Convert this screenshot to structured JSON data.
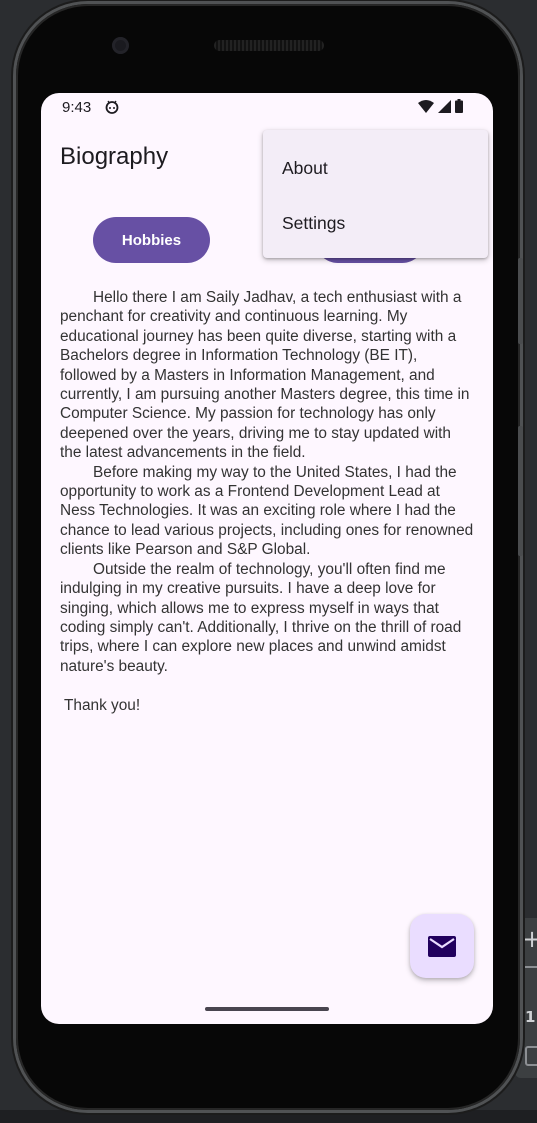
{
  "status_bar": {
    "time": "9:43",
    "left_icon": "android-head-icon",
    "right_icons": [
      "wifi-icon",
      "cell-signal-icon",
      "battery-icon"
    ]
  },
  "app_bar": {
    "title": "Biography"
  },
  "buttons": {
    "hobbies_label": "Hobbies"
  },
  "overflow_menu": {
    "items": [
      {
        "label": "About"
      },
      {
        "label": "Settings"
      }
    ]
  },
  "bio": {
    "paragraphs": [
      "Hello there I am Saily Jadhav, a tech enthusiast with a penchant for creativity and continuous learning. My educational journey has been quite diverse, starting with a Bachelors degree in Information Technology (BE IT), followed by a Masters in Information Management, and currently, I am pursuing another Masters degree, this time in Computer Science. My passion for technology has only deepened over the years, driving me to stay updated with the latest advancements in the field.",
      "Before making my way to the United States, I had the opportunity to work as a Frontend Development Lead at Ness Technologies. It was an exciting role where I had the chance to lead various projects, including ones for renowned clients like Pearson and S&P Global.",
      "Outside the realm of technology, you'll often find me indulging in my creative pursuits. I have a deep love for singing, which allows me to express myself in ways that coding simply can't. Additionally, I thrive on the thrill of road trips, where I can explore new places and unwind amidst nature's beauty."
    ],
    "closing": "Thank you!"
  },
  "fab": {
    "icon": "email-icon"
  },
  "ide_panel": {
    "label": "1:"
  },
  "colors": {
    "primary": "#6750a4",
    "surface": "#fef7ff",
    "menu_surface": "#f3edf7",
    "fab_container": "#eaddff",
    "fab_icon": "#21005d"
  }
}
